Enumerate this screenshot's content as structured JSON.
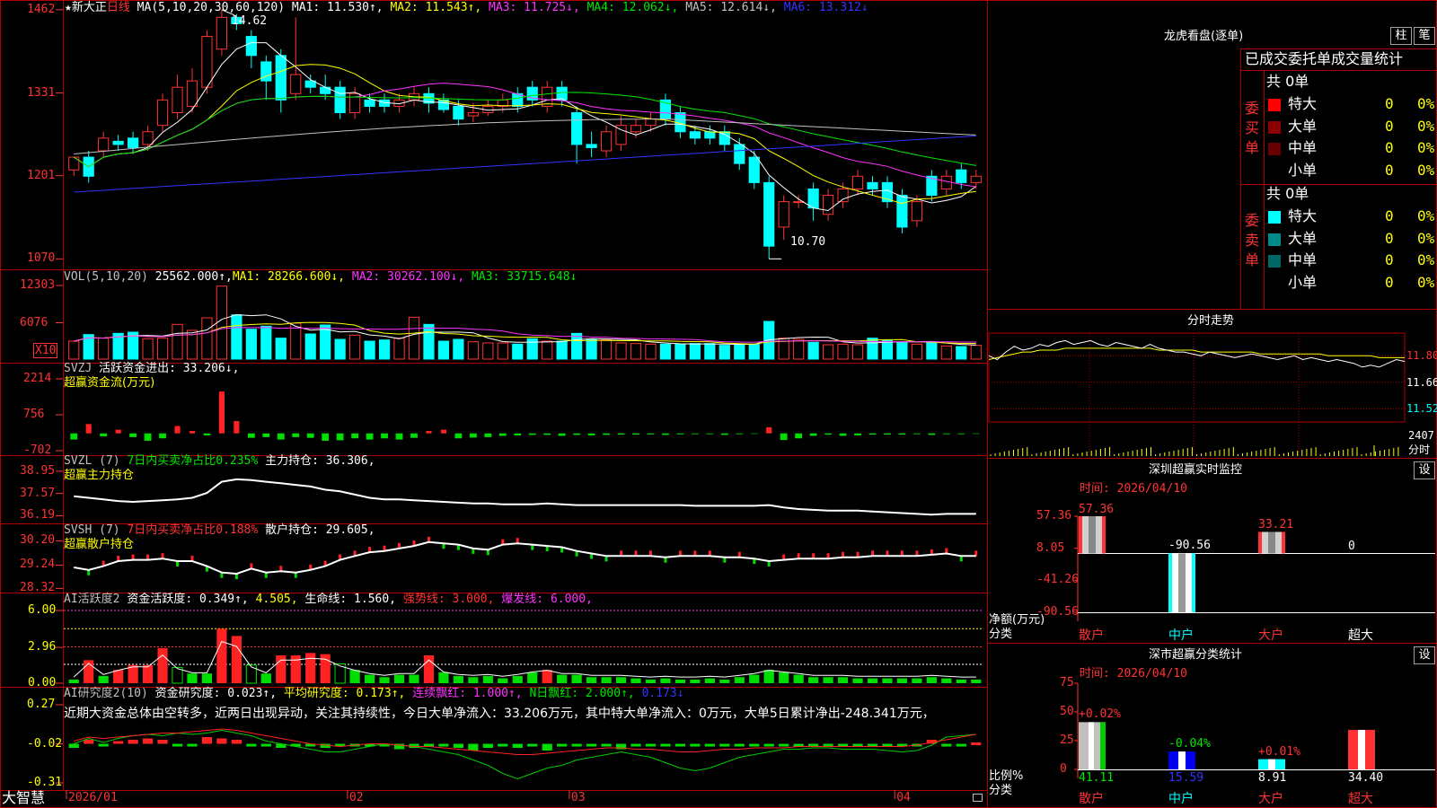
{
  "colors": {
    "up": "#ff3333",
    "down": "#00ffff",
    "frame": "#b00000",
    "ma1": "#ffffff",
    "ma2": "#ffff00",
    "ma3": "#ff33ff",
    "ma4": "#00e600",
    "ma5": "#c0c0c0",
    "ma6": "#3333ff"
  },
  "kline": {
    "title_stock": "★新大正",
    "title_period": "日线",
    "title_ma": "MA(5,10,20,30,60,120)",
    "ma_values": [
      {
        "label": "MA1: 11.530↑,",
        "color": "#ffffff"
      },
      {
        "label": "MA2: 11.543↑,",
        "color": "#ffff00"
      },
      {
        "label": "MA3: 11.725↓,",
        "color": "#ff33ff"
      },
      {
        "label": "MA4: 12.062↓,",
        "color": "#00e600"
      },
      {
        "label": "MA5: 12.614↓,",
        "color": "#c0c0c0"
      },
      {
        "label": "MA6: 13.312↓",
        "color": "#3333ff"
      }
    ],
    "y_ticks": [
      "1462",
      "1331",
      "1201",
      "1070"
    ],
    "high_label": "14.62",
    "low_label": "10.70",
    "ylim": [
      10.62,
      14.66
    ],
    "candles": [
      [
        12.1,
        12.3,
        12.0,
        12.25
      ],
      [
        12.3,
        12.0,
        11.9,
        12.4
      ],
      [
        12.4,
        12.6,
        12.3,
        12.7
      ],
      [
        12.55,
        12.5,
        12.4,
        12.65
      ],
      [
        12.6,
        12.45,
        12.35,
        12.7
      ],
      [
        12.5,
        12.7,
        12.4,
        12.8
      ],
      [
        12.8,
        13.2,
        12.7,
        13.3
      ],
      [
        13.0,
        13.4,
        12.9,
        13.6
      ],
      [
        13.1,
        13.5,
        13.0,
        13.7
      ],
      [
        13.4,
        14.2,
        13.3,
        14.3
      ],
      [
        14.0,
        14.5,
        13.9,
        14.62
      ],
      [
        14.5,
        14.4,
        14.3,
        14.55
      ],
      [
        14.2,
        13.9,
        13.7,
        14.3
      ],
      [
        13.8,
        13.5,
        13.2,
        13.9
      ],
      [
        13.9,
        13.2,
        13.0,
        14.0
      ],
      [
        13.3,
        13.6,
        13.2,
        14.5
      ],
      [
        13.5,
        13.4,
        13.3,
        13.6
      ],
      [
        13.4,
        13.3,
        13.2,
        13.6
      ],
      [
        13.4,
        13.0,
        12.9,
        13.5
      ],
      [
        13.0,
        13.3,
        12.9,
        13.4
      ],
      [
        13.2,
        13.1,
        13.0,
        13.3
      ],
      [
        13.2,
        13.1,
        13.0,
        13.3
      ],
      [
        13.1,
        13.2,
        13.0,
        13.3
      ],
      [
        13.2,
        13.3,
        13.1,
        13.4
      ],
      [
        13.3,
        13.15,
        13.0,
        13.4
      ],
      [
        13.2,
        13.05,
        13.0,
        13.3
      ],
      [
        13.1,
        12.9,
        12.8,
        13.2
      ],
      [
        12.95,
        13.0,
        12.85,
        13.15
      ],
      [
        13.0,
        13.1,
        12.95,
        13.2
      ],
      [
        13.1,
        13.2,
        13.0,
        13.3
      ],
      [
        13.3,
        13.1,
        13.0,
        13.4
      ],
      [
        13.4,
        13.2,
        13.1,
        13.5
      ],
      [
        13.1,
        13.4,
        13.0,
        13.5
      ],
      [
        13.4,
        13.2,
        13.1,
        13.5
      ],
      [
        13.0,
        12.5,
        12.2,
        13.1
      ],
      [
        12.5,
        12.45,
        12.3,
        12.7
      ],
      [
        12.4,
        12.7,
        12.3,
        12.8
      ],
      [
        12.5,
        12.8,
        12.4,
        12.95
      ],
      [
        12.7,
        12.8,
        12.6,
        12.9
      ],
      [
        12.8,
        12.9,
        12.7,
        13.0
      ],
      [
        13.2,
        12.9,
        12.8,
        13.3
      ],
      [
        13.0,
        12.7,
        12.6,
        13.1
      ],
      [
        12.7,
        12.6,
        12.5,
        12.8
      ],
      [
        12.7,
        12.6,
        12.5,
        12.8
      ],
      [
        12.7,
        12.5,
        12.4,
        12.8
      ],
      [
        12.5,
        12.2,
        12.1,
        12.6
      ],
      [
        12.3,
        11.9,
        11.8,
        12.4
      ],
      [
        11.9,
        10.9,
        10.7,
        12.0
      ],
      [
        11.2,
        11.6,
        11.0,
        11.7
      ],
      [
        11.6,
        11.6,
        11.5,
        11.7
      ],
      [
        11.8,
        11.5,
        11.3,
        11.9
      ],
      [
        11.4,
        11.7,
        11.3,
        11.8
      ],
      [
        11.6,
        11.8,
        11.5,
        11.9
      ],
      [
        11.8,
        12.0,
        11.7,
        12.1
      ],
      [
        11.9,
        11.8,
        11.7,
        12.0
      ],
      [
        11.9,
        11.6,
        11.5,
        12.0
      ],
      [
        11.7,
        11.2,
        11.1,
        11.8
      ],
      [
        11.3,
        11.6,
        11.2,
        11.7
      ],
      [
        12.0,
        11.7,
        11.6,
        12.1
      ],
      [
        11.8,
        12.0,
        11.7,
        12.1
      ],
      [
        12.1,
        11.9,
        11.8,
        12.2
      ],
      [
        11.9,
        12.0,
        11.8,
        12.1
      ]
    ]
  },
  "vol": {
    "title": "VOL(5,10,20)",
    "value": "25562.000↑,",
    "ma1": "MA1: 28266.600↓,",
    "ma2": "MA2: 30262.100↓,",
    "ma3": "MA3: 33715.648↓",
    "y_ticks": [
      "12303",
      "6076"
    ],
    "x10": "X10",
    "ymax": 12303,
    "bars": [
      3000,
      4100,
      3500,
      4300,
      4500,
      3400,
      3500,
      5800,
      4800,
      6900,
      12200,
      7400,
      5000,
      5500,
      3500,
      6000,
      4200,
      5700,
      3300,
      4000,
      3000,
      3200,
      3500,
      7000,
      5800,
      3000,
      3300,
      2900,
      2700,
      2700,
      2500,
      3400,
      3000,
      3000,
      4300,
      3300,
      3200,
      2700,
      2600,
      2500,
      2500,
      2500,
      2600,
      2600,
      2300,
      2400,
      2500,
      6300,
      3500,
      3300,
      2800,
      2400,
      2500,
      2400,
      3500,
      3200,
      2800,
      2500,
      2700,
      2200,
      2100,
      2300
    ]
  },
  "svzj": {
    "title": "SVZJ",
    "label": "活跃资金进出:",
    "value": "33.206↓,",
    "sub": "超赢资金流(万元)",
    "y_ticks": [
      "2214",
      "756",
      "-702"
    ],
    "ylim": [
      -702,
      2214
    ],
    "bars": [
      -250,
      380,
      -120,
      150,
      -150,
      -300,
      -200,
      300,
      100,
      -80,
      1700,
      500,
      -180,
      -150,
      -250,
      -150,
      -180,
      -300,
      -280,
      -200,
      -250,
      -200,
      -250,
      -180,
      100,
      150,
      -200,
      -170,
      -150,
      -100,
      -80,
      -60,
      -60,
      -100,
      -60,
      -80,
      -60,
      -50,
      -50,
      -40,
      -60,
      -40,
      -30,
      -30,
      -60,
      -30,
      -20,
      250,
      -270,
      -200,
      -100,
      -50,
      -100,
      -80,
      -50,
      -50,
      -50,
      -30,
      -60,
      -30,
      -30,
      -20
    ]
  },
  "svzl": {
    "title": "SVZL (7)",
    "desc": "7日内买卖净占比0.235%",
    "label": "主力持仓:",
    "value": "36.306",
    "comma": ",",
    "sub": "超赢主力持仓",
    "y_ticks": [
      "38.95",
      "37.57",
      "36.19"
    ],
    "ylim": [
      36.1,
      39.0
    ],
    "line": [
      37.4,
      37.3,
      37.2,
      37.1,
      37.05,
      37.1,
      37.15,
      37.2,
      37.3,
      37.6,
      38.3,
      38.45,
      38.4,
      38.3,
      38.2,
      38.1,
      38.0,
      37.8,
      37.7,
      37.5,
      37.3,
      37.2,
      37.2,
      37.15,
      37.1,
      37.05,
      37.0,
      36.95,
      36.95,
      36.9,
      36.9,
      36.9,
      36.95,
      36.9,
      36.85,
      36.85,
      36.85,
      36.85,
      36.85,
      36.85,
      36.85,
      36.85,
      36.8,
      36.8,
      36.8,
      36.8,
      36.8,
      36.85,
      36.7,
      36.6,
      36.55,
      36.5,
      36.5,
      36.5,
      36.45,
      36.4,
      36.35,
      36.3,
      36.25,
      36.3,
      36.3,
      36.3
    ]
  },
  "svsh": {
    "title": "SVSH (7)",
    "desc": "7日内买卖净占比0.188%",
    "label": "散户持仓:",
    "value": "29.605",
    "comma": ",",
    "sub": "超赢散户持仓",
    "y_ticks": [
      "30.20",
      "29.24",
      "28.32"
    ],
    "ylim": [
      28.3,
      30.25
    ],
    "line": [
      29.15,
      29.05,
      29.2,
      29.4,
      29.45,
      29.45,
      29.5,
      29.4,
      29.4,
      29.2,
      28.95,
      28.9,
      29.1,
      28.95,
      29.0,
      28.95,
      29.05,
      29.2,
      29.45,
      29.6,
      29.75,
      29.8,
      29.9,
      30.0,
      30.15,
      30.1,
      30.05,
      29.9,
      29.85,
      30.05,
      30.1,
      30.05,
      30.0,
      29.95,
      29.8,
      29.7,
      29.6,
      29.6,
      29.6,
      29.6,
      29.55,
      29.6,
      29.6,
      29.6,
      29.55,
      29.55,
      29.5,
      29.4,
      29.45,
      29.5,
      29.5,
      29.5,
      29.55,
      29.55,
      29.6,
      29.6,
      29.6,
      29.6,
      29.65,
      29.7,
      29.6,
      29.6
    ]
  },
  "ai_active": {
    "title": "AI活跃度2",
    "label": "资金活跃度:",
    "value": "0.349↑,",
    "v2": "4.505,",
    "life": "生命线: 1.560,",
    "strong": "强势线: 3.000,",
    "burst": "爆发线: 6.000,",
    "y_ticks": [
      "6.00",
      "2.96",
      "0.00"
    ],
    "ylim": [
      0,
      6.3
    ],
    "bars": [
      0.3,
      1.9,
      0.6,
      1.1,
      1.5,
      1.5,
      2.9,
      1.3,
      0.8,
      0.8,
      4.5,
      3.9,
      1.5,
      0.8,
      2.3,
      2.3,
      2.5,
      2.4,
      1.6,
      1.1,
      0.7,
      0.5,
      0.7,
      0.7,
      2.3,
      0.9,
      0.6,
      0.5,
      0.6,
      0.4,
      0.6,
      0.9,
      1.1,
      0.7,
      0.7,
      0.5,
      0.5,
      0.5,
      0.4,
      0.3,
      0.4,
      0.3,
      0.3,
      0.4,
      0.3,
      0.5,
      0.7,
      1.1,
      0.9,
      0.7,
      0.5,
      0.5,
      0.5,
      0.4,
      0.4,
      0.4,
      0.4,
      0.4,
      0.5,
      0.4,
      0.3,
      0.3
    ],
    "colors": [
      1,
      1,
      0,
      1,
      1,
      1,
      1,
      0,
      0,
      0,
      1,
      1,
      0,
      0,
      1,
      1,
      1,
      1,
      0,
      0,
      0,
      0,
      0,
      0,
      1,
      0,
      0,
      0,
      0,
      1,
      0,
      0,
      1,
      0,
      0,
      0,
      0,
      0,
      0,
      0,
      0,
      0,
      0,
      0,
      0,
      0,
      0,
      0,
      0,
      0,
      0,
      0,
      0,
      0,
      0,
      0,
      0,
      0,
      1,
      0,
      0,
      0
    ]
  },
  "ai_research": {
    "title": "AI研究度2(10)",
    "label": "资金研究度:",
    "value": "0.023↑,",
    "avg": "平均研究度: 0.173↑,",
    "cont": "连续飘红: 1.000↑,",
    "nday": "N日飘红: 2.000↑,",
    "last": "0.173↓",
    "y_ticks": [
      "0.27",
      "-0.02",
      "-0.31"
    ],
    "comment": "近期大资金总体由空转多，近两日出现异动，关注其持续性，今日大单净流入：33.206万元，其中特大单净流入：0万元，大单5日累计净出-248.341万元，",
    "ylim": [
      -0.33,
      0.29
    ],
    "bars": [
      -0.05,
      0.03,
      -0.04,
      0.02,
      0.03,
      0.04,
      0.03,
      -0.03,
      -0.03,
      0.05,
      0.04,
      0.03,
      -0.04,
      -0.03,
      -0.05,
      -0.03,
      -0.04,
      -0.05,
      -0.04,
      -0.04,
      -0.03,
      -0.04,
      -0.06,
      -0.05,
      -0.04,
      -0.03,
      -0.05,
      -0.07,
      -0.05,
      -0.04,
      -0.05,
      -0.04,
      -0.07,
      -0.04,
      -0.04,
      -0.03,
      -0.04,
      -0.06,
      -0.03,
      -0.03,
      -0.02,
      -0.03,
      -0.03,
      -0.02,
      -0.03,
      -0.03,
      -0.02,
      -0.02,
      -0.04,
      -0.04,
      -0.03,
      -0.03,
      -0.03,
      -0.02,
      -0.03,
      -0.02,
      -0.03,
      -0.02,
      0.03,
      -0.02,
      -0.03,
      0.01
    ],
    "green_line": [
      -0.02,
      0.02,
      -0.01,
      0.02,
      0.04,
      0.05,
      0.04,
      0.06,
      0.05,
      0.06,
      0.08,
      0.06,
      0.04,
      0.0,
      -0.02,
      -0.04,
      -0.06,
      -0.08,
      -0.08,
      -0.06,
      -0.04,
      -0.02,
      -0.03,
      -0.04,
      -0.06,
      -0.08,
      -0.1,
      -0.14,
      -0.18,
      -0.24,
      -0.28,
      -0.24,
      -0.2,
      -0.18,
      -0.14,
      -0.12,
      -0.1,
      -0.08,
      -0.1,
      -0.12,
      -0.16,
      -0.2,
      -0.22,
      -0.2,
      -0.16,
      -0.12,
      -0.1,
      -0.08,
      -0.06,
      -0.06,
      -0.05,
      -0.05,
      -0.06,
      -0.06,
      -0.06,
      -0.07,
      -0.08,
      -0.07,
      -0.03,
      0.03,
      0.04,
      0.05
    ],
    "red_line": [
      0.0,
      0.03,
      0.02,
      0.03,
      0.04,
      0.05,
      0.06,
      0.06,
      0.07,
      0.08,
      0.09,
      0.08,
      0.06,
      0.04,
      0.02,
      0.0,
      -0.02,
      -0.03,
      -0.04,
      -0.03,
      -0.02,
      -0.02,
      -0.03,
      -0.04,
      -0.04,
      -0.05,
      -0.06,
      -0.07,
      -0.08,
      -0.09,
      -0.1,
      -0.1,
      -0.09,
      -0.08,
      -0.07,
      -0.06,
      -0.05,
      -0.05,
      -0.06,
      -0.06,
      -0.07,
      -0.08,
      -0.08,
      -0.07,
      -0.06,
      -0.06,
      -0.05,
      -0.05,
      -0.05,
      -0.04,
      -0.04,
      -0.04,
      -0.04,
      -0.04,
      -0.04,
      -0.04,
      -0.04,
      -0.03,
      -0.01,
      0.01,
      0.03,
      0.05
    ]
  },
  "xaxis": {
    "labels": [
      "2026/01",
      "02",
      "03",
      "04"
    ],
    "brand": "大智慧"
  },
  "lhb": {
    "title": "龙虎看盘(逐单)",
    "btn1": "柱",
    "btn2": "笔",
    "headline": "已成交委托单成交量统计",
    "buy": {
      "side": "委买单",
      "total": "共 0单",
      "rows": [
        {
          "name": "特大",
          "n": "0",
          "p": "0%"
        },
        {
          "name": "大单",
          "n": "0",
          "p": "0%"
        },
        {
          "name": "中单",
          "n": "0",
          "p": "0%"
        },
        {
          "name": "小单",
          "n": "0",
          "p": "0%"
        }
      ]
    },
    "sell": {
      "side": "委卖单",
      "total": "共 0单",
      "rows": [
        {
          "name": "特大",
          "n": "0",
          "p": "0%"
        },
        {
          "name": "大单",
          "n": "0",
          "p": "0%"
        },
        {
          "name": "中单",
          "n": "0",
          "p": "0%"
        },
        {
          "name": "小单",
          "n": "0",
          "p": "0%"
        }
      ]
    },
    "buy_colors": [
      "#ff0000",
      "#8b0000",
      "#660000"
    ],
    "sell_colors": [
      "#00ffff",
      "#008b8b",
      "#006666"
    ]
  },
  "intraday": {
    "title": "分时走势",
    "y_ticks": [
      "11.80",
      "11.66",
      "11.52"
    ],
    "vol_label": "2407",
    "unit": "分时",
    "ylim": [
      11.45,
      11.92
    ],
    "price": [
      11.8,
      11.78,
      11.82,
      11.85,
      11.83,
      11.84,
      11.86,
      11.85,
      11.87,
      11.88,
      11.86,
      11.87,
      11.88,
      11.86,
      11.85,
      11.87,
      11.86,
      11.85,
      11.84,
      11.86,
      11.84,
      11.83,
      11.82,
      11.82,
      11.81,
      11.8,
      11.82,
      11.81,
      11.8,
      11.79,
      11.8,
      11.81,
      11.8,
      11.79,
      11.78,
      11.79,
      11.8,
      11.78,
      11.79,
      11.78,
      11.77,
      11.78,
      11.77,
      11.76,
      11.74,
      11.75,
      11.74,
      11.76,
      11.78,
      11.77
    ],
    "avg": [
      11.78,
      11.79,
      11.8,
      11.81,
      11.82,
      11.82,
      11.83,
      11.83,
      11.83,
      11.84,
      11.84,
      11.84,
      11.84,
      11.84,
      11.84,
      11.84,
      11.84,
      11.84,
      11.84,
      11.84,
      11.83,
      11.83,
      11.83,
      11.83,
      11.83,
      11.82,
      11.82,
      11.82,
      11.82,
      11.82,
      11.82,
      11.82,
      11.81,
      11.81,
      11.81,
      11.81,
      11.81,
      11.81,
      11.81,
      11.81,
      11.8,
      11.8,
      11.8,
      11.8,
      11.8,
      11.8,
      11.79,
      11.79,
      11.79,
      11.79
    ]
  },
  "sz_monitor": {
    "title": "深圳超赢实时监控",
    "btn": "设",
    "time": "时间: 2026/04/10",
    "y_ticks": [
      "57.36",
      "8.05",
      "-41.26",
      "-90.56"
    ],
    "ylabel": "净额(万元)",
    "xcat": "分类",
    "ylim": [
      -90.56,
      57.36
    ],
    "cats": [
      {
        "name": "散户",
        "value": 57.36,
        "label": "57.36",
        "color": "#ff3333"
      },
      {
        "name": "中户",
        "value": -90.56,
        "label": "-90.56",
        "color": "#00ffff"
      },
      {
        "name": "大户",
        "value": 33.21,
        "label": "33.21",
        "color": "#ff3333"
      },
      {
        "name": "超大",
        "value": 0,
        "label": "0",
        "color": "#ffffff"
      }
    ]
  },
  "sz_stats": {
    "title": "深市超赢分类统计",
    "btn": "设",
    "time": "时间: 2026/04/10",
    "y_ticks": [
      "75",
      "50",
      "25",
      "0"
    ],
    "ylabel": "比例%",
    "xcat": "分类",
    "ylim": [
      0,
      75
    ],
    "cats": [
      {
        "name": "散户",
        "value": 41.11,
        "label": "41.11",
        "change": "+0.02%",
        "bar": "#c0c0c0",
        "accent": "#00cc00"
      },
      {
        "name": "中户",
        "value": 15.59,
        "label": "15.59",
        "change": "-0.04%",
        "bar": "#0000ee",
        "accent": "#0000ee"
      },
      {
        "name": "大户",
        "value": 8.91,
        "label": "8.91",
        "change": "+0.01%",
        "bar": "#00ffff",
        "accent": "#00ffff"
      },
      {
        "name": "超大",
        "value": 34.4,
        "label": "34.40",
        "change": "",
        "bar": "#ff3333",
        "accent": "#ff3333"
      }
    ]
  }
}
